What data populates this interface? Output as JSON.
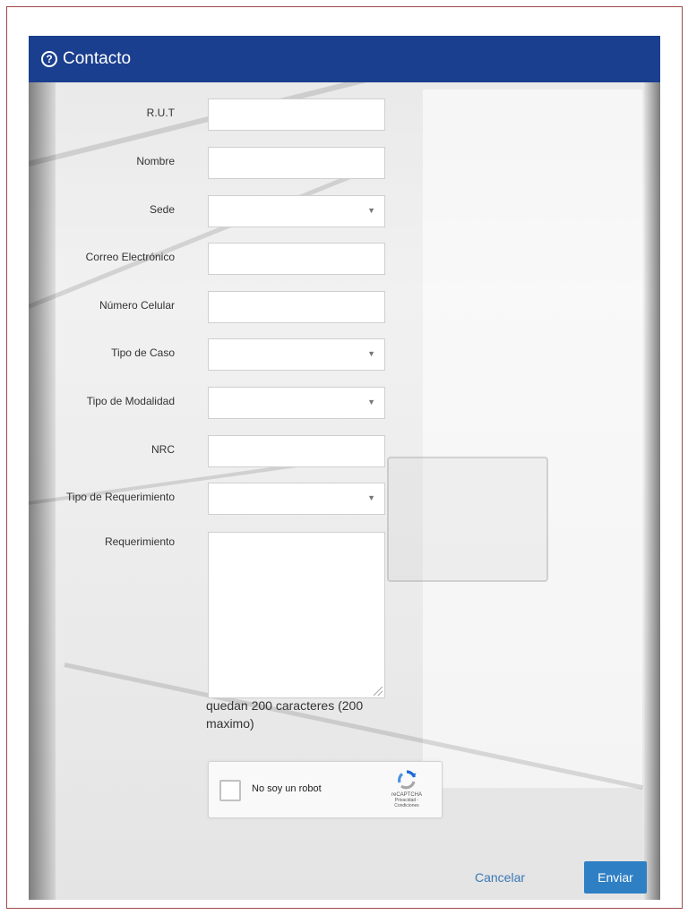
{
  "header": {
    "icon": "question-circle-icon",
    "title": "Contacto"
  },
  "fields": [
    {
      "label": "R.U.T",
      "type": "text",
      "value": ""
    },
    {
      "label": "Nombre",
      "type": "text",
      "value": ""
    },
    {
      "label": "Sede",
      "type": "select",
      "value": ""
    },
    {
      "label": "Correo Electrónico",
      "type": "text",
      "value": ""
    },
    {
      "label": "Número Celular",
      "type": "text",
      "value": ""
    },
    {
      "label": "Tipo de Caso",
      "type": "select",
      "value": ""
    },
    {
      "label": "Tipo de Modalidad",
      "type": "select",
      "value": ""
    },
    {
      "label": "NRC",
      "type": "text",
      "value": ""
    },
    {
      "label": "Tipo de Requerimiento",
      "type": "select",
      "value": ""
    }
  ],
  "requirement": {
    "label": "Requerimiento",
    "value": "",
    "counter": "quedan 200 caracteres (200 maximo)"
  },
  "captcha": {
    "label": "No soy un robot",
    "brand": "reCAPTCHA",
    "links": "Privacidad - Condiciones",
    "icon": "recaptcha-logo-icon"
  },
  "actions": {
    "cancel": "Cancelar",
    "send": "Enviar"
  },
  "colors": {
    "header": "#1b3f8f",
    "primary_button": "#2f7fc4",
    "link": "#3a78b6",
    "frame_border": "#a04a4a"
  }
}
